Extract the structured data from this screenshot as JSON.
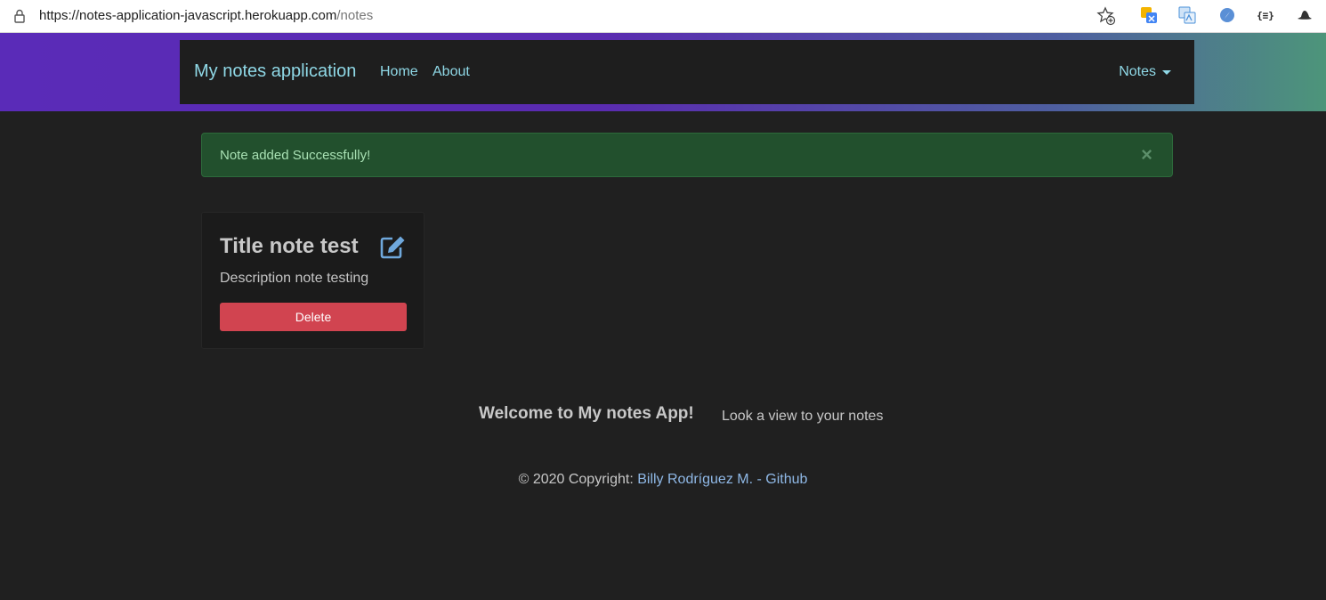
{
  "browser": {
    "url_host": "https://notes-application-javascript.herokuapp.com",
    "url_path": "/notes",
    "extensions": [
      "translate-icon",
      "image-translate-icon",
      "safari-compass-icon",
      "json-viewer-icon",
      "hat-icon"
    ],
    "ext4_label": "{≡}"
  },
  "navbar": {
    "brand": "My notes application",
    "home": "Home",
    "about": "About",
    "notes": "Notes"
  },
  "alert": {
    "message": "Note added Successfully!",
    "close": "×"
  },
  "notes": [
    {
      "title": "Title note test",
      "description": "Description note testing",
      "delete_label": "Delete"
    }
  ],
  "welcome": {
    "title": "Welcome to My notes App!",
    "subtitle": "Look a view to your notes"
  },
  "footer": {
    "copyright": "© 2020 Copyright: ",
    "link": "Billy Rodríguez M. - Github"
  },
  "colors": {
    "accent": "#8fd8e6",
    "alert_bg": "#22502d",
    "delete": "#d14450",
    "edit_icon": "#6fa8dc"
  }
}
